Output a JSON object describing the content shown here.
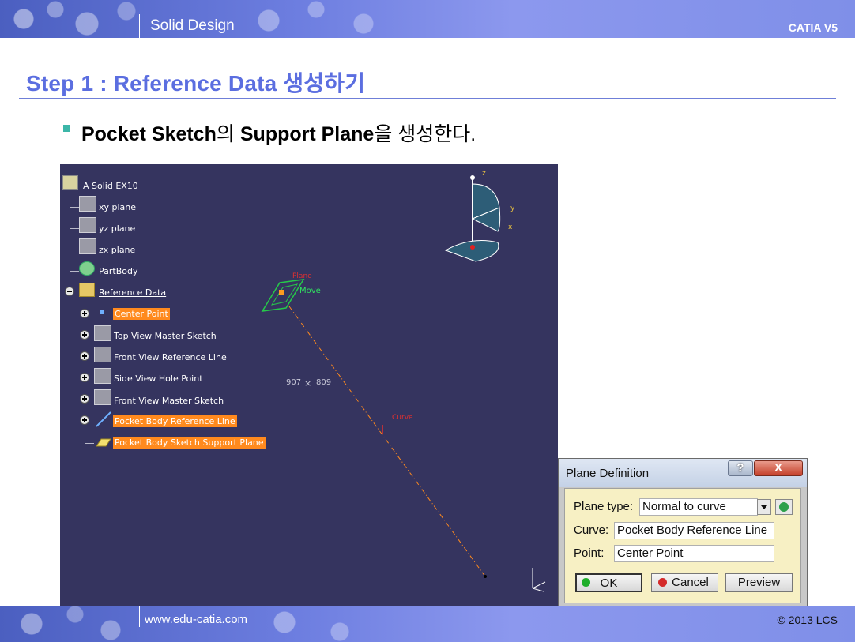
{
  "header": {
    "section": "Solid Design",
    "brand": "CATIA V5"
  },
  "step": {
    "title": "Step 1 : Reference Data 생성하기",
    "bullet_a": "Pocket Sketch",
    "bullet_b": "의 ",
    "bullet_c": "Support Plane",
    "bullet_d": "을 생성한다."
  },
  "tree": {
    "root": "A Solid EX10",
    "xy": "xy plane",
    "yz": "yz plane",
    "zx": "zx plane",
    "partbody": "PartBody",
    "refdata": "Reference Data",
    "items": [
      "Center Point",
      "Top View Master Sketch",
      "Front View Reference Line",
      "Side View Hole Point",
      "Front View Master Sketch",
      "Pocket Body Reference Line",
      "Pocket Body Sketch Support Plane"
    ]
  },
  "viewport": {
    "coord_x": "907",
    "coord_sep": "×",
    "coord_y": "809",
    "plane_label": "Plane",
    "move_label": "Move",
    "curve_label": "Curve",
    "axis_z": "z",
    "axis_y": "y",
    "axis_x": "x"
  },
  "dialog": {
    "title": "Plane Definition",
    "help": "?",
    "close": "X",
    "plane_type_label": "Plane type:",
    "plane_type_value": "Normal to curve",
    "curve_label": "Curve:",
    "curve_value": "Pocket Body Reference Line",
    "point_label": "Point:",
    "point_value": "Center Point",
    "ok": "OK",
    "cancel": "Cancel",
    "preview": "Preview"
  },
  "footer": {
    "url": "www.edu-catia.com",
    "copyright": "© 2013 LCS"
  },
  "colors": {
    "accent": "#5b6ee0",
    "viewport_bg": "#35345f",
    "highlight": "#ff8a1e",
    "dialog_body": "#f7f0c4"
  }
}
